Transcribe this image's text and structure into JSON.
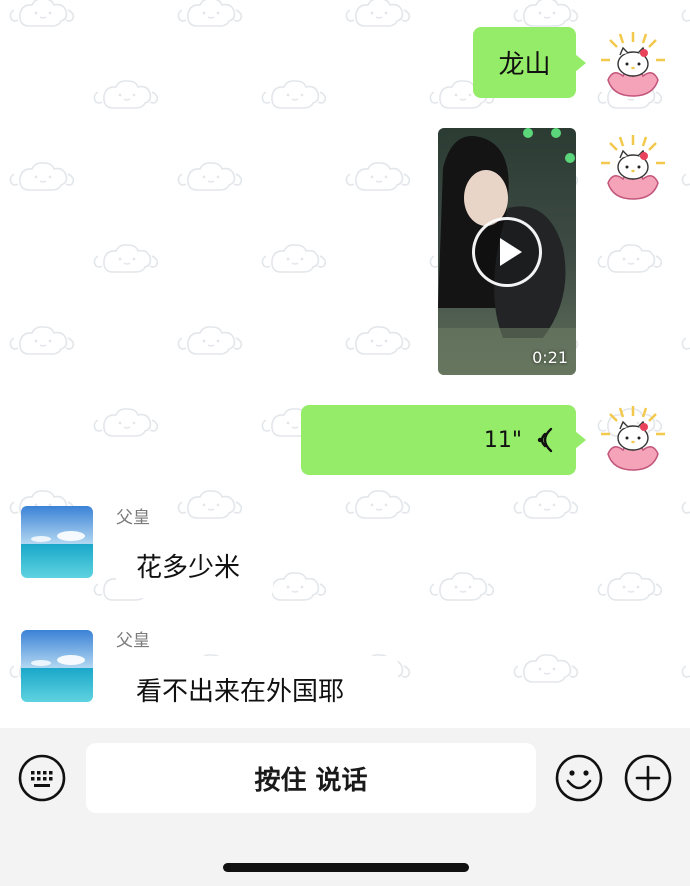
{
  "messages": [
    {
      "direction": "outgoing",
      "type": "text",
      "text": "龙山"
    },
    {
      "direction": "outgoing",
      "type": "video",
      "duration": "0:21"
    },
    {
      "direction": "outgoing",
      "type": "voice",
      "duration": "11\""
    },
    {
      "direction": "incoming",
      "type": "text",
      "sender": "父皇",
      "text": "花多少米"
    },
    {
      "direction": "incoming",
      "type": "text",
      "sender": "父皇",
      "text": "看不出来在外国耶"
    }
  ],
  "input_bar": {
    "hold_to_talk_label": "按住 说话",
    "left_icon": "keyboard-icon",
    "right_icons": [
      "emoji-icon",
      "plus-icon"
    ]
  },
  "colors": {
    "outgoing_bubble": "#95ec69",
    "incoming_bubble": "#ffffff",
    "input_bar_bg": "#f3f3f3"
  }
}
